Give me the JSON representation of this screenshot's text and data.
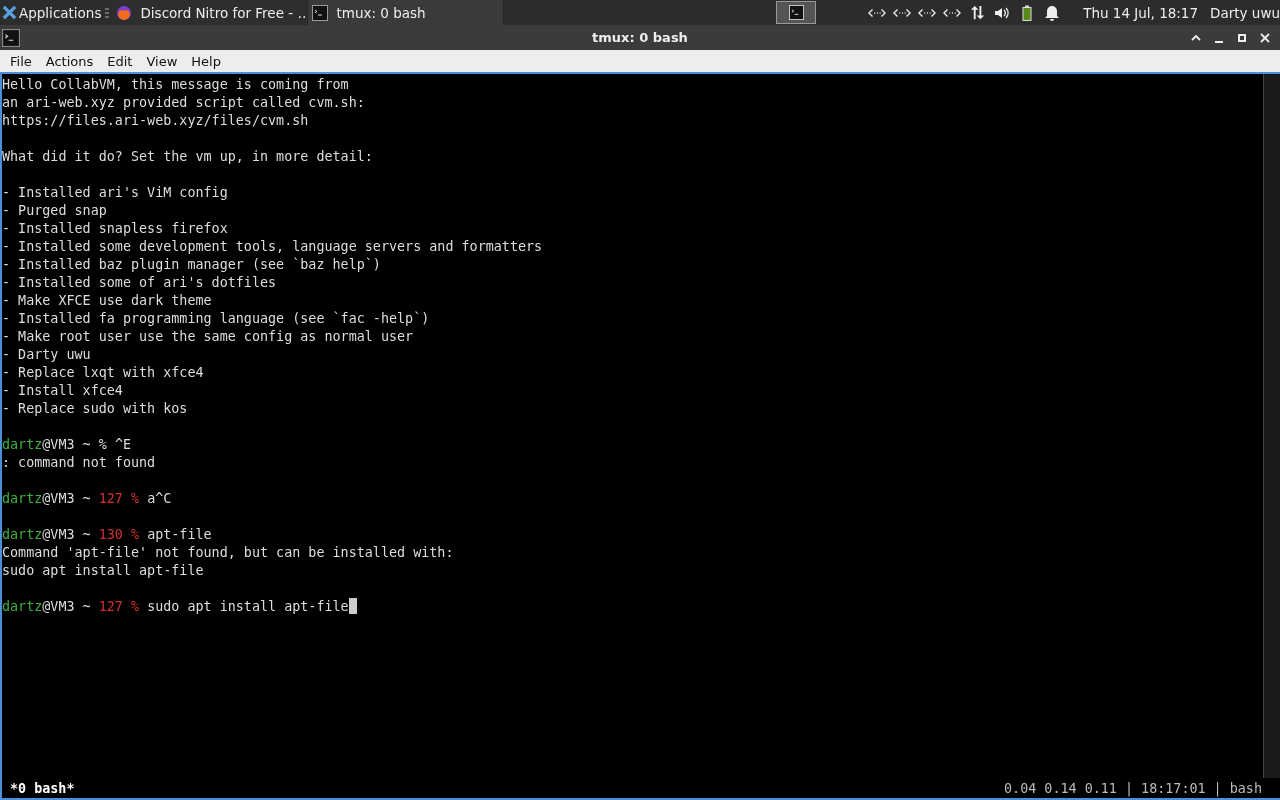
{
  "taskbar": {
    "app_menu": "Applications",
    "tasks": [
      {
        "title": "Discord Nitro for Free - …",
        "kind": "browser",
        "selected": false
      },
      {
        "title": "tmux: 0 bash",
        "kind": "terminal",
        "selected": true
      }
    ],
    "workspaces": [
      {
        "selected": true
      }
    ],
    "clock": "Thu 14 Jul, 18:17",
    "user": "Darty uwu"
  },
  "window": {
    "title": "tmux: 0 bash"
  },
  "menu": [
    "File",
    "Actions",
    "Edit",
    "View",
    "Help"
  ],
  "terminal": {
    "lines": [
      {
        "kind": "text",
        "text": "Hello CollabVM, this message is coming from"
      },
      {
        "kind": "text",
        "text": "an ari-web.xyz provided script called cvm.sh:"
      },
      {
        "kind": "text",
        "text": "https://files.ari-web.xyz/files/cvm.sh"
      },
      {
        "kind": "blank"
      },
      {
        "kind": "text",
        "text": "What did it do? Set the vm up, in more detail:"
      },
      {
        "kind": "blank"
      },
      {
        "kind": "text",
        "text": "- Installed ari's ViM config"
      },
      {
        "kind": "text",
        "text": "- Purged snap"
      },
      {
        "kind": "text",
        "text": "- Installed snapless firefox"
      },
      {
        "kind": "text",
        "text": "- Installed some development tools, language servers and formatters"
      },
      {
        "kind": "text",
        "text": "- Installed baz plugin manager (see `baz help`)"
      },
      {
        "kind": "text",
        "text": "- Installed some of ari's dotfiles"
      },
      {
        "kind": "text",
        "text": "- Make XFCE use dark theme"
      },
      {
        "kind": "text",
        "text": "- Installed fa programming language (see `fac -help`)"
      },
      {
        "kind": "text",
        "text": "- Make root user use the same config as normal user"
      },
      {
        "kind": "text",
        "text": "- Darty uwu"
      },
      {
        "kind": "text",
        "text": "- Replace lxqt with xfce4"
      },
      {
        "kind": "text",
        "text": "- Install xfce4"
      },
      {
        "kind": "text",
        "text": "- Replace sudo with kos"
      },
      {
        "kind": "blank"
      },
      {
        "kind": "prompt",
        "user": "dartz",
        "host": "@VM3 ~",
        "sign": "%",
        "command": "^E",
        "cursor": false
      },
      {
        "kind": "text",
        "text": ": command not found"
      },
      {
        "kind": "blank"
      },
      {
        "kind": "prompt",
        "user": "dartz",
        "host": "@VM3 ~",
        "status": "127 %",
        "command": "a^C",
        "cursor": false
      },
      {
        "kind": "blank"
      },
      {
        "kind": "prompt",
        "user": "dartz",
        "host": "@VM3 ~",
        "status": "130 %",
        "command": "apt-file",
        "cursor": false
      },
      {
        "kind": "text",
        "text": "Command 'apt-file' not found, but can be installed with:"
      },
      {
        "kind": "text",
        "text": "sudo apt install apt-file"
      },
      {
        "kind": "blank"
      },
      {
        "kind": "prompt",
        "user": "dartz",
        "host": "@VM3 ~",
        "status": "127 %",
        "command": "sudo apt install apt-file",
        "cursor": true
      }
    ]
  },
  "status_bar": {
    "window_list": "*0 bash*",
    "info": "0.04 0.14 0.11 | 18:17:01 | bash"
  }
}
